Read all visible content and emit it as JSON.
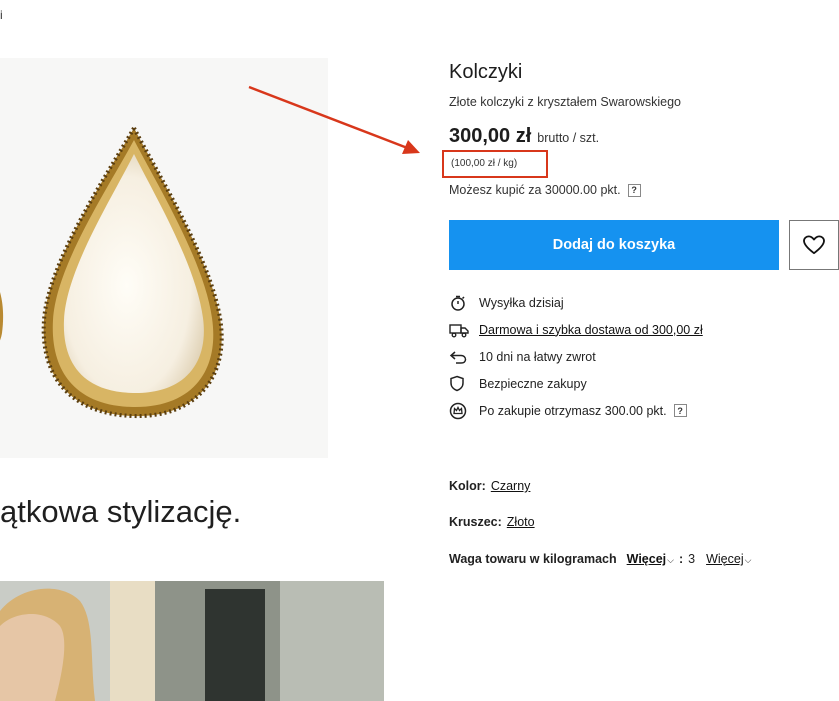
{
  "breadcrumb": {
    "fragment": "i"
  },
  "product": {
    "title": "Kolczyki",
    "subtitle": "Złote kolczyki z kryształem Swarowskiego",
    "price": "300,00 zł",
    "price_unit": "brutto / szt.",
    "unit_price": "(100,00 zł / kg)",
    "points_text": "Możesz kupić za 30000.00 pkt.",
    "help_label": "?"
  },
  "actions": {
    "add_to_cart_label": "Dodaj do koszyka"
  },
  "features": [
    {
      "icon": "stopwatch-icon",
      "text": "Wysyłka dzisiaj"
    },
    {
      "icon": "delivery-truck-icon",
      "text": "Darmowa i szybka dostawa od 300,00 zł"
    },
    {
      "icon": "return-arrow-icon",
      "text": "10 dni na łatwy zwrot"
    },
    {
      "icon": "shield-icon",
      "text": "Bezpieczne zakupy"
    },
    {
      "icon": "reward-crown-icon",
      "text": "Po zakupie otrzymasz 300.00 pkt.",
      "help": "?"
    }
  ],
  "attributes": {
    "color_label": "Kolor:",
    "color_value": "Czarny",
    "metal_label": "Kruszec:",
    "metal_value": "Złoto",
    "weight_label": "Waga towaru w kilogramach",
    "weight_more": "Więcej",
    "weight_separator": ":",
    "weight_value": "3",
    "weight_more2": "Więcej"
  },
  "description": {
    "tagline_fragment": "ątkowa stylizację."
  },
  "colors": {
    "accent": "#1592f0",
    "annotation": "#d8371b"
  }
}
